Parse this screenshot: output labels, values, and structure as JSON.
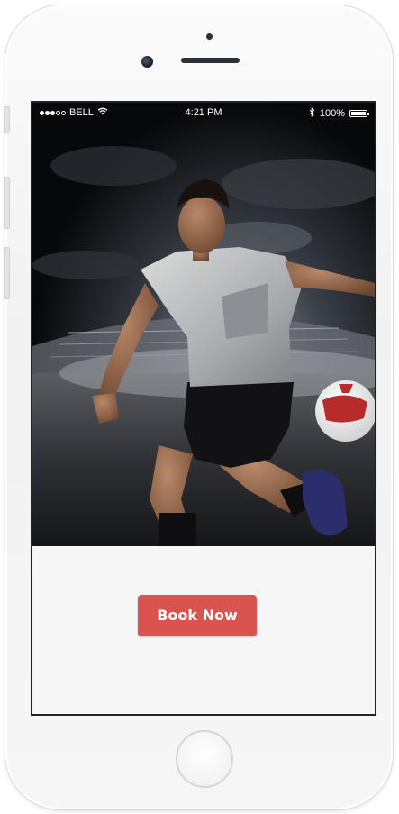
{
  "status_bar": {
    "carrier": "BELL",
    "time": "4:21 PM",
    "battery": "100%",
    "battery_level": 1.0,
    "signal_dots_filled": 3,
    "signal_dots_total": 5
  },
  "hero": {
    "image": "soccer-player-kicking-ball-photo"
  },
  "cta": {
    "label": "Book Now",
    "color": "#d9534f"
  },
  "icons": {
    "wifi": "wifi-icon",
    "bluetooth": "bluetooth-icon",
    "battery": "battery-icon"
  }
}
